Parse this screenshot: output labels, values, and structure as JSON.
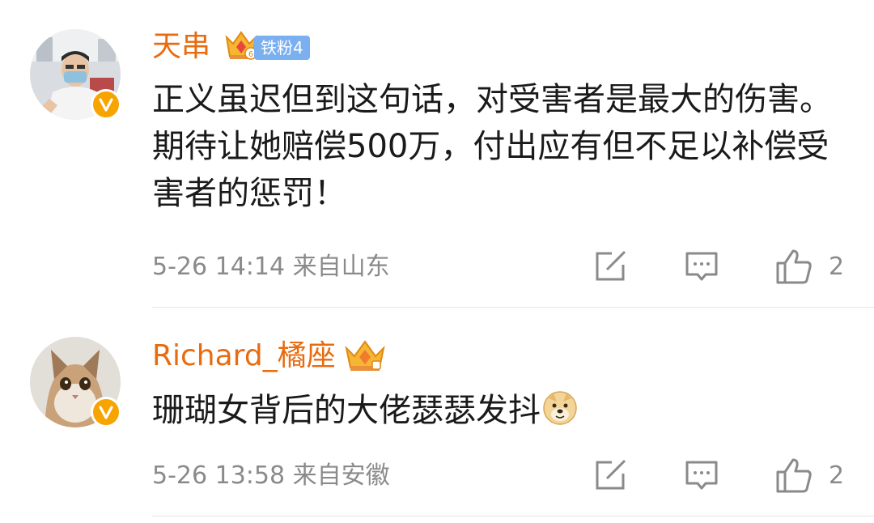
{
  "comments": [
    {
      "username": "天串",
      "fan_badge": "铁粉4",
      "text": "正义虽迟但到这句话，对受害者是最大的伤害。期待让她赔偿500万，付出应有但不足以补偿受害者的惩罚！",
      "timestamp": "5-26 14:14",
      "location": "来自山东",
      "like_count": "2"
    },
    {
      "username": "Richard_橘座",
      "text": "珊瑚女背后的大佬瑟瑟发抖",
      "timestamp": "5-26 13:58",
      "location": "来自安徽",
      "like_count": "2"
    }
  ],
  "colors": {
    "username": "#e86b0f",
    "verified": "#f7a400",
    "fan_badge": "#7aaff0",
    "meta": "#8a8a8a"
  },
  "icons": [
    "verified-icon",
    "crown-icon",
    "forward-icon",
    "reply-icon",
    "like-icon",
    "doge-emoji-icon"
  ]
}
